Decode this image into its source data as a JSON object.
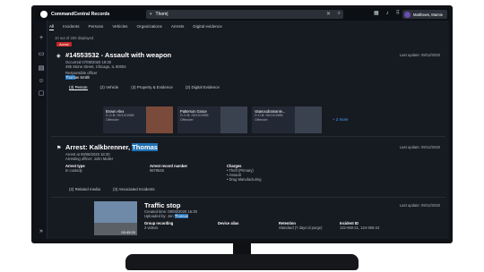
{
  "app": {
    "title": "CommandCentral Records"
  },
  "search": {
    "filter_label": "▾",
    "value": "Thom|",
    "clear_icon": "close-icon",
    "search_icon": "search-icon"
  },
  "topbar_icons": [
    "grid-icon",
    "bell-icon",
    "apps-icon"
  ],
  "user": {
    "name": "Matthews, Marnie"
  },
  "sidebar_icons": [
    "plus-icon",
    "briefcase-icon",
    "document-icon",
    "person-icon",
    "monitor-icon",
    "expand-icon"
  ],
  "tabs": [
    "All",
    "Incidents",
    "Persons",
    "Vehicles",
    "Organizations",
    "Arrests",
    "Digital evidence"
  ],
  "result_count": "10 out of 200 displayed",
  "incident": {
    "badge": "Arrest",
    "title": "#14553532 - Assault with weapon",
    "occurred": "Occurred 07/08/2020 19:30",
    "address": "495 Stone Street, Chicago, IL 60004",
    "officer_label": "Responsible officer",
    "officer_pre": "",
    "officer_hl": "Thom",
    "officer_post": "as Smith",
    "last_update": "Last update: 09/12/2020",
    "subtabs": [
      "(3) Person",
      "(2) Vehicle",
      "(3) Property & Evidence",
      "(2) Digital Evidence"
    ],
    "persons": [
      {
        "name": "Brown Alex",
        "dob": "D.O.B: 05/10/1988",
        "role": "Offender"
      },
      {
        "name": "Patterson Grace",
        "dob": "D.O.B: 05/10/1988",
        "role": "Offender"
      },
      {
        "name": "Vaanoudramanie...",
        "dob": "D.O.B: 05/10/1988",
        "role": "Offender"
      }
    ],
    "more": "+ 2 more"
  },
  "arrest": {
    "title_pre": "Arrest: Kalkbrenner, ",
    "title_hl": "Thomas",
    "arrested_at": "Arrest at 09/08/2020 18:30",
    "arresting_officer": "Arresting officer: John Muller",
    "last_update": "Last update: 09/12/2020",
    "fields": [
      {
        "label": "Arrest type",
        "value": "In custody"
      },
      {
        "label": "Arrest record number",
        "value": "9878545"
      },
      {
        "label": "Charges",
        "value": "• Theft (Primary)"
      }
    ],
    "more_charges": [
      "• Assault",
      "• Drug Manufacturing"
    ],
    "links": [
      "(2) Related media",
      "(3) Associated Incidents"
    ]
  },
  "media": {
    "title": "Traffic stop",
    "created": "Created time: 09/08/2020 15:30",
    "uploaded_pre": "Uploaded by: Jon ",
    "uploaded_hl": "Thomas",
    "duration": "00:45:20",
    "last_update": "Last update: 09/12/2020",
    "fields": [
      {
        "label": "Group recording",
        "value": "2 videos"
      },
      {
        "label": "Device alias",
        "value": ""
      },
      {
        "label": "Retention",
        "value": "Standard (7 days id purge)"
      },
      {
        "label": "Incident ID",
        "value": "132-660-21, 124-356-24"
      }
    ]
  }
}
